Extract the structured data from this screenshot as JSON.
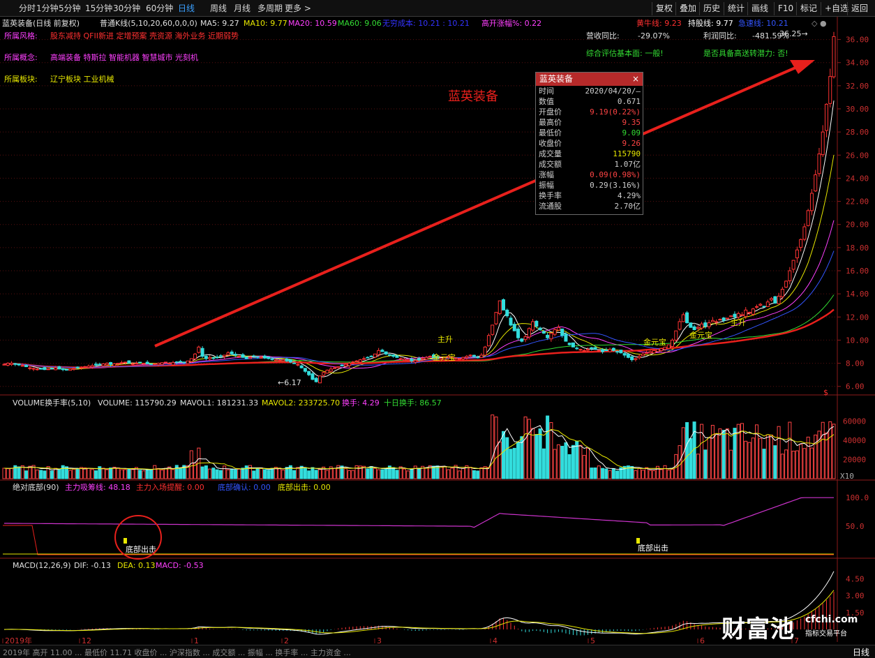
{
  "toolbar": {
    "periods": [
      "分时",
      "1分钟",
      "5分钟",
      "15分钟",
      "30分钟",
      "60分钟",
      "日线",
      "周线",
      "月线",
      "多周期",
      "更多 >"
    ],
    "active_period": "日线",
    "right_buttons": [
      "复权",
      "叠加",
      "历史",
      "统计",
      "画线",
      "F10",
      "标记",
      "+自选",
      "返回"
    ]
  },
  "header": {
    "title": "蓝英装备(日线 前复权)",
    "indicator": "普通K线(5,10,20,60,0,0,0)",
    "ma5": "MA5: 9.27",
    "ma10": "MA10: 9.77",
    "ma20": "MA20: 10.59",
    "ma60": "MA60: 9.06",
    "cost": "无穷成本: 10.21 : 10.21",
    "gap": "高开涨幅%: 0.22",
    "bull": "黄牛线: 9.23",
    "hold": "持股线: 9.77",
    "fast": "急速线: 10.21"
  },
  "info": {
    "style_label": "所属风格:",
    "style_value": "股东减持 QFII新进 定增预案 壳资源 海外业务 近期弱势",
    "concept_label": "所属概念:",
    "concept_value": "高端装备 特斯拉 智能机器 智慧城市 光刻机",
    "sector_label": "所属板块:",
    "sector_value": "辽宁板块   工业机械",
    "rev_label": "营收同比:",
    "rev_value": "-29.07%",
    "profit_label": "利润同比:",
    "profit_value": "-481.59%",
    "eval": "综合评估基本面: 一般!",
    "potential": "是否具备高送转潜力: 否!"
  },
  "stock_name_overlay": "蓝英装备",
  "popup": {
    "title": "蓝英装备",
    "close": "×",
    "rows": [
      {
        "label": "时间",
        "value": "2020/04/20/—",
        "color": "#d0d0d0"
      },
      {
        "label": "数值",
        "value": "0.671",
        "color": "#d0d0d0"
      },
      {
        "label": "开盘价",
        "value": "9.19(0.22%)",
        "color": "#ff4444"
      },
      {
        "label": "最高价",
        "value": "9.35",
        "color": "#ff4444"
      },
      {
        "label": "最低价",
        "value": "9.09",
        "color": "#33dd33"
      },
      {
        "label": "收盘价",
        "value": "9.26",
        "color": "#ff4444"
      },
      {
        "label": "成交量",
        "value": "115790",
        "color": "#e8e800"
      },
      {
        "label": "成交额",
        "value": "1.07亿",
        "color": "#d0d0d0"
      },
      {
        "label": "涨幅",
        "value": "0.09(0.98%)",
        "color": "#ff4444"
      },
      {
        "label": "振幅",
        "value": "0.29(3.16%)",
        "color": "#d0d0d0"
      },
      {
        "label": "换手率",
        "value": "4.29%",
        "color": "#d0d0d0"
      },
      {
        "label": "流通股",
        "value": "2.70亿",
        "color": "#d0d0d0"
      }
    ]
  },
  "annotations": {
    "low_mark": "←6.17",
    "high_mark": "36.25→",
    "signal_main": "主升",
    "signal_gold": "金元宝",
    "bottom_out": "底部出击",
    "dollar": "$"
  },
  "volume_panel": {
    "title": "VOLUME换手率(5,10)",
    "volume": "VOLUME: 115790.29",
    "mavol1": "MAVOL1: 181231.33",
    "mavol2": "MAVOL2: 233725.70",
    "turnover": "换手: 4.29",
    "ten_day": "十日换手: 86.57",
    "axis": [
      "60000",
      "40000",
      "20000"
    ],
    "unit": "X10"
  },
  "bottom_panel": {
    "title": "绝对底部(90)",
    "absorb": "主力吸筹线: 48.18",
    "enter": "主力入场提醒: 0.00",
    "confirm": "底部确认: 0.00",
    "out": "底部出击: 0.00",
    "axis": [
      "100.0",
      "50.0"
    ]
  },
  "macd_panel": {
    "title": "MACD(12,26,9)",
    "dif": "DIF: -0.13",
    "dea": "DEA: 0.13",
    "macd": "MACD: -0.53",
    "axis": [
      "4.50",
      "3.00",
      "1.50"
    ]
  },
  "date_axis": [
    "2019年",
    "12",
    "1",
    "2",
    "3",
    "4",
    "5",
    "6",
    "7"
  ],
  "bottom_status": "2019年 高开 11.00 ... 最低价 11.71 收盘价 ... 沪深指数 ... 成交额 ... 振幅 ... 换手率 ... 主力资金 ...",
  "bottom_period": "日线",
  "watermark": {
    "name": "财富池",
    "domain": "cfchi.com",
    "sub": "指标交易平台"
  },
  "chart_data": {
    "type": "candlestick",
    "title": "蓝英装备(日线 前复权)",
    "ylim": [
      5.5,
      37.0
    ],
    "yticks": [
      6,
      8,
      10,
      12,
      14,
      16,
      18,
      20,
      22,
      24,
      26,
      28,
      30,
      32,
      34,
      36
    ],
    "closes": [
      7.9,
      8.0,
      8.0,
      7.9,
      7.85,
      7.8,
      7.7,
      7.6,
      7.55,
      7.5,
      7.5,
      7.45,
      7.5,
      7.55,
      7.6,
      7.5,
      7.45,
      7.4,
      7.5,
      7.55,
      7.6,
      7.65,
      7.7,
      7.75,
      7.8,
      7.85,
      7.9,
      7.95,
      8.0,
      7.9,
      7.95,
      8.0,
      8.05,
      8.1,
      8.0,
      7.95,
      8.0,
      8.05,
      8.0,
      7.95,
      7.9,
      7.95,
      8.0,
      8.05,
      8.1,
      8.0,
      8.05,
      8.1,
      8.15,
      8.1,
      8.2,
      8.4,
      8.8,
      9.4,
      8.6,
      8.4,
      8.5,
      8.45,
      8.5,
      8.6,
      8.7,
      8.9,
      8.8,
      8.7,
      8.6,
      8.5,
      8.4,
      8.5,
      8.6,
      8.55,
      8.5,
      8.45,
      8.4,
      8.35,
      8.3,
      8.25,
      8.3,
      8.2,
      8.1,
      8.0,
      7.9,
      7.6,
      7.3,
      7.0,
      6.6,
      6.4,
      6.9,
      7.2,
      7.4,
      7.5,
      7.6,
      7.7,
      7.8,
      7.9,
      8.0,
      8.1,
      8.2,
      8.3,
      8.4,
      8.5,
      8.6,
      8.8,
      9.1,
      9.0,
      8.8,
      8.7,
      8.6,
      8.5,
      8.4,
      8.35,
      8.3,
      8.2,
      8.25,
      8.3,
      8.4,
      8.5,
      8.6,
      8.5,
      8.45,
      8.4,
      8.5,
      8.6,
      8.5,
      8.45,
      8.4,
      8.5,
      8.6,
      8.7,
      8.6,
      8.5,
      8.7,
      9.4,
      10.4,
      11.3,
      12.4,
      13.4,
      12.6,
      12.1,
      11.3,
      10.8,
      10.2,
      9.9,
      10.3,
      11.0,
      11.6,
      11.2,
      10.9,
      10.6,
      10.2,
      10.6,
      10.9,
      11.1,
      10.4,
      9.9,
      9.6,
      9.4,
      9.3,
      9.2,
      9.1,
      9.2,
      9.3,
      9.2,
      9.1,
      9.0,
      9.1,
      9.2,
      9.1,
      9.0,
      8.9,
      8.7,
      8.5,
      8.3,
      8.4,
      8.6,
      8.8,
      8.9,
      9.0,
      9.1,
      9.2,
      9.26,
      9.4,
      9.6,
      10.0,
      10.8,
      11.6,
      12.2,
      11.5,
      11.1,
      10.9,
      11.1,
      11.4,
      11.2,
      11.5,
      11.7,
      11.6,
      11.8,
      11.7,
      11.9,
      12.1,
      12.0,
      12.3,
      12.2,
      12.6,
      12.4,
      12.7,
      12.9,
      13.1,
      12.9,
      13.3,
      13.6,
      13.2,
      13.8,
      14.4,
      15.1,
      16.0,
      16.9,
      17.8,
      18.7,
      19.8,
      21.2,
      22.7,
      24.3,
      26.1,
      28.0,
      30.4,
      32.8,
      36.25
    ],
    "ma_lines": [
      "MA5",
      "MA10",
      "MA20",
      "MA60"
    ],
    "volume_scale": [
      0,
      70000
    ],
    "bottom_scale": [
      0,
      110
    ],
    "macd_scale": [
      -0.8,
      5.2
    ]
  }
}
